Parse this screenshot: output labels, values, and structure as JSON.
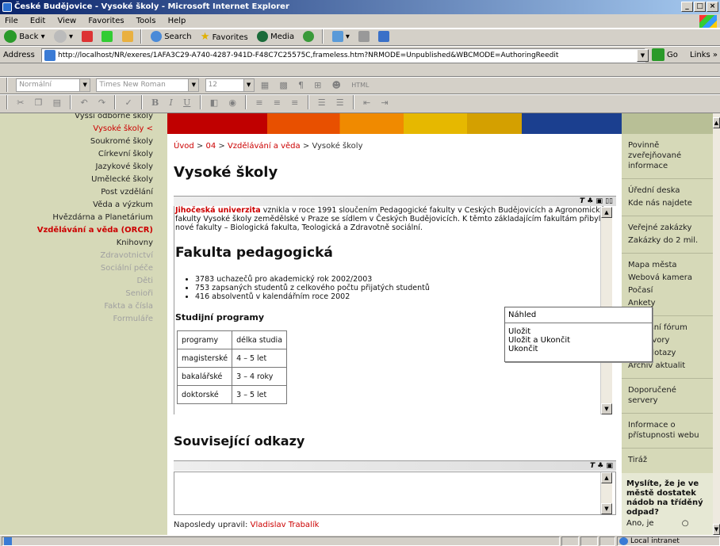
{
  "window": {
    "title": "České Budějovice - Vysoké školy - Microsoft Internet Explorer"
  },
  "menu": [
    "File",
    "Edit",
    "View",
    "Favorites",
    "Tools",
    "Help"
  ],
  "toolbar": {
    "back": "Back",
    "search": "Search",
    "favorites": "Favorites",
    "media": "Media"
  },
  "address": {
    "label": "Address",
    "url": "http://localhost/NR/exeres/1AFA3C29-A740-4287-941D-F48C7C25575C,frameless.htm?NRMODE=Unpublished&WBCMODE=AuthoringReedit",
    "go": "Go",
    "links": "Links"
  },
  "format": {
    "style": "Normální",
    "font": "Times New Roman",
    "size": "12",
    "html": "HTML",
    "bold": "B",
    "italic": "I",
    "underline": "U"
  },
  "leftnav": [
    {
      "label": "Vyšší odborné školy",
      "state": "normal"
    },
    {
      "label": "Vysoké školy  <",
      "state": "active"
    },
    {
      "label": "Soukromé školy",
      "state": "normal"
    },
    {
      "label": "Církevní školy",
      "state": "normal"
    },
    {
      "label": "Jazykové školy",
      "state": "normal"
    },
    {
      "label": "Umělecké školy",
      "state": "normal"
    },
    {
      "label": "Post vzdělání",
      "state": "normal"
    },
    {
      "label": "Věda a výzkum",
      "state": "normal"
    },
    {
      "label": "Hvězdárna a Planetárium",
      "state": "normal"
    },
    {
      "label": "Vzdělávání a věda (ORCR)",
      "state": "bold"
    },
    {
      "label": "Knihovny",
      "state": "normal"
    },
    {
      "label": "Zdravotnictví",
      "state": "dim"
    },
    {
      "label": "Sociální péče",
      "state": "dim"
    },
    {
      "label": "Děti",
      "state": "dim"
    },
    {
      "label": "Senioři",
      "state": "dim"
    },
    {
      "label": "Fakta a čísla",
      "state": "dim"
    },
    {
      "label": "Formuláře",
      "state": "dim"
    }
  ],
  "breadcrumb": {
    "c1": "Úvod",
    "c2": "04",
    "c3": "Vzdělávání a věda",
    "c4": "Vysoké školy",
    "sep": ">"
  },
  "page": {
    "title": "Vysoké školy",
    "related": "Související odkazy"
  },
  "editor": {
    "uni": "Jihočeská univerzita",
    "intro": " vznikla v roce 1991 sloučením Pedagogické fakulty v Českých Budějovicích a Agronomické fakulty Vysoké školy zemědělské v Praze se sídlem v Českých Budějovicích. K těmto základajícím fakultám přibyly nové fakulty – Biologická fakulta, Teologická a Zdravotně sociální.",
    "faculty": "Fakulta pedagogická",
    "bullets": [
      "3783 uchazečů pro akademický rok 2002/2003",
      "753 zapsaných studentů z celkového počtu přijatých studentů",
      "416 absolventů v kalendářním roce 2002"
    ],
    "programs_title": "Studijní programy",
    "table": [
      [
        "programy",
        "délka studia"
      ],
      [
        "magisterské",
        "4 – 5 let"
      ],
      [
        "bakalářské",
        "3 – 4 roky"
      ],
      [
        "doktorské",
        "3 – 5 let"
      ]
    ]
  },
  "lastmod": {
    "label": "Naposledy upravil: ",
    "name": "Vladislav Trabalík"
  },
  "rightnav": [
    [
      "Povinně zveřejňované informace"
    ],
    [
      "Úřední deska",
      "Kde nás najdete"
    ],
    [
      "Veřejné zakázky",
      "Zakázky do 2 mil."
    ],
    [
      "Mapa města",
      "Webová kamera",
      "Počasí",
      "Ankety"
    ],
    [
      "Diskusní fórum",
      "Rozhovory",
      "Vaše dotazy",
      "Archiv aktualit"
    ],
    [
      "Doporučené servery"
    ],
    [
      "Informace o přístupnosti webu"
    ],
    [
      "Tiráž"
    ]
  ],
  "poll": {
    "question": "Myslíte, že je ve městě dostatek nádob na tříděný odpad?",
    "option": "Ano, je"
  },
  "popup": {
    "title": "Náhled",
    "items": [
      "Uložit",
      "Uložit a Ukončit",
      "Ukončit"
    ]
  },
  "status": {
    "zone": "Local intranet"
  }
}
